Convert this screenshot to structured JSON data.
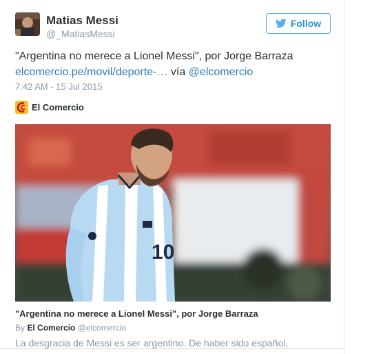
{
  "user": {
    "name": "Matias Messi",
    "handle": "@_MatiasMessi"
  },
  "follow_button": {
    "label": "Follow",
    "icon": "twitter-bird-icon"
  },
  "tweet": {
    "text": "\"Argentina no merece a Lionel Messi\", por Jorge Barraza",
    "link": "elcomercio.pe/movil/deporte-…",
    "via_word": "vía",
    "mention": "@elcomercio",
    "timestamp": "7:42 AM - 15 Jul 2015"
  },
  "source": {
    "name": "El Comercio",
    "logo_icon": "el-comercio-logo"
  },
  "card": {
    "title": "\"Argentina no merece a Lionel Messi\", por Jorge Barraza",
    "by_prefix": "By",
    "by_name": "El Comercio",
    "by_handle": "@elcomercio",
    "description": "La desgracia de Messi es ser argentino. De haber sido español,"
  },
  "colors": {
    "link": "#2b7bb9",
    "follow_accent": "#55acee",
    "muted": "#8899a6",
    "text": "#292f33"
  }
}
